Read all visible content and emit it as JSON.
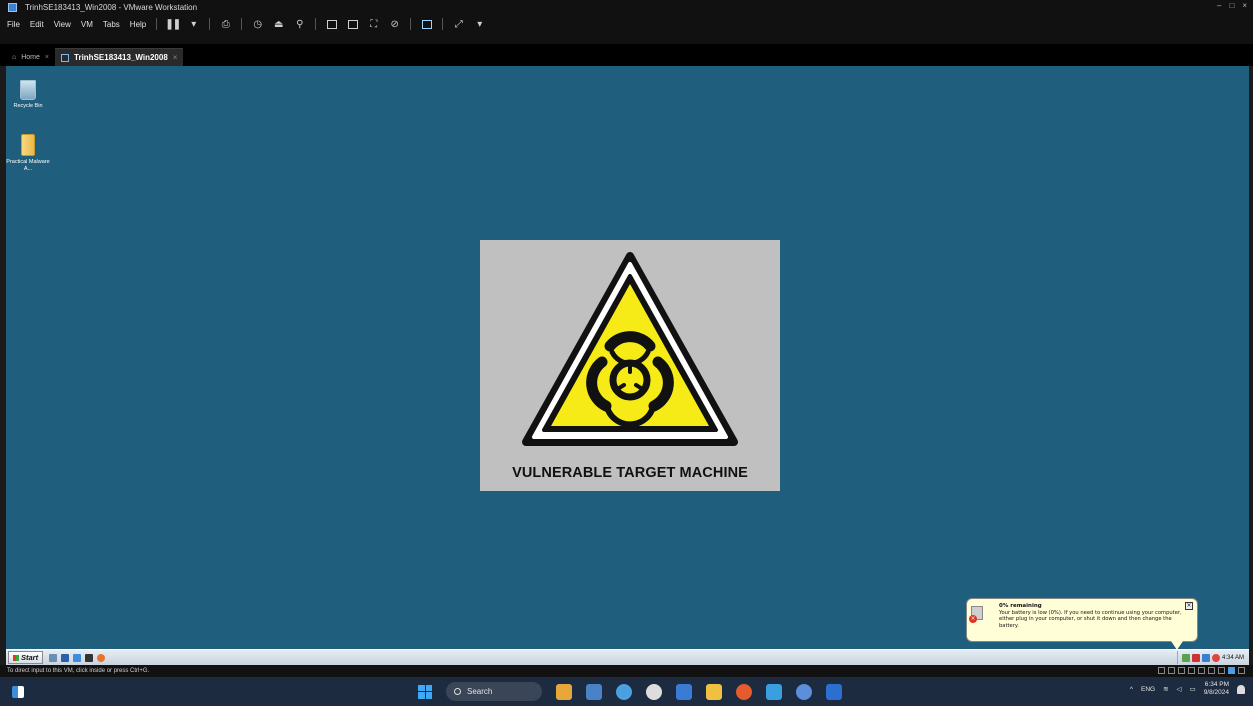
{
  "window": {
    "title": "TrinhSE183413_Win2008 - VMware Workstation",
    "controls": [
      "–",
      "□",
      "×"
    ]
  },
  "menu": [
    "File",
    "Edit",
    "View",
    "VM",
    "Tabs",
    "Help"
  ],
  "tabs": [
    {
      "label": "Home",
      "close": "×"
    },
    {
      "label": "TrinhSE183413_Win2008",
      "close": "×"
    }
  ],
  "desktop": {
    "background_color": "#1f5f7d",
    "icons": [
      {
        "label": "Recycle Bin",
        "icon": "recycle-bin-icon"
      },
      {
        "label": "Practical Malware A...",
        "icon": "folder-icon"
      }
    ],
    "wallpaper_text": "VULNERABLE TARGET MACHINE"
  },
  "notification": {
    "title": "0% remaining",
    "body": "Your battery is low (0%). If you need to continue using your computer, either plug in your computer, or shut it down and then change the battery.",
    "close": "×"
  },
  "guest_taskbar": {
    "start_label": "Start",
    "clock": "4:34 AM"
  },
  "vm_status": {
    "hint": "To direct input to this VM, click inside or press Ctrl+G."
  },
  "host_taskbar": {
    "search_placeholder": "Search",
    "language": "ENG",
    "time": "6:34 PM",
    "date": "9/8/2024"
  }
}
